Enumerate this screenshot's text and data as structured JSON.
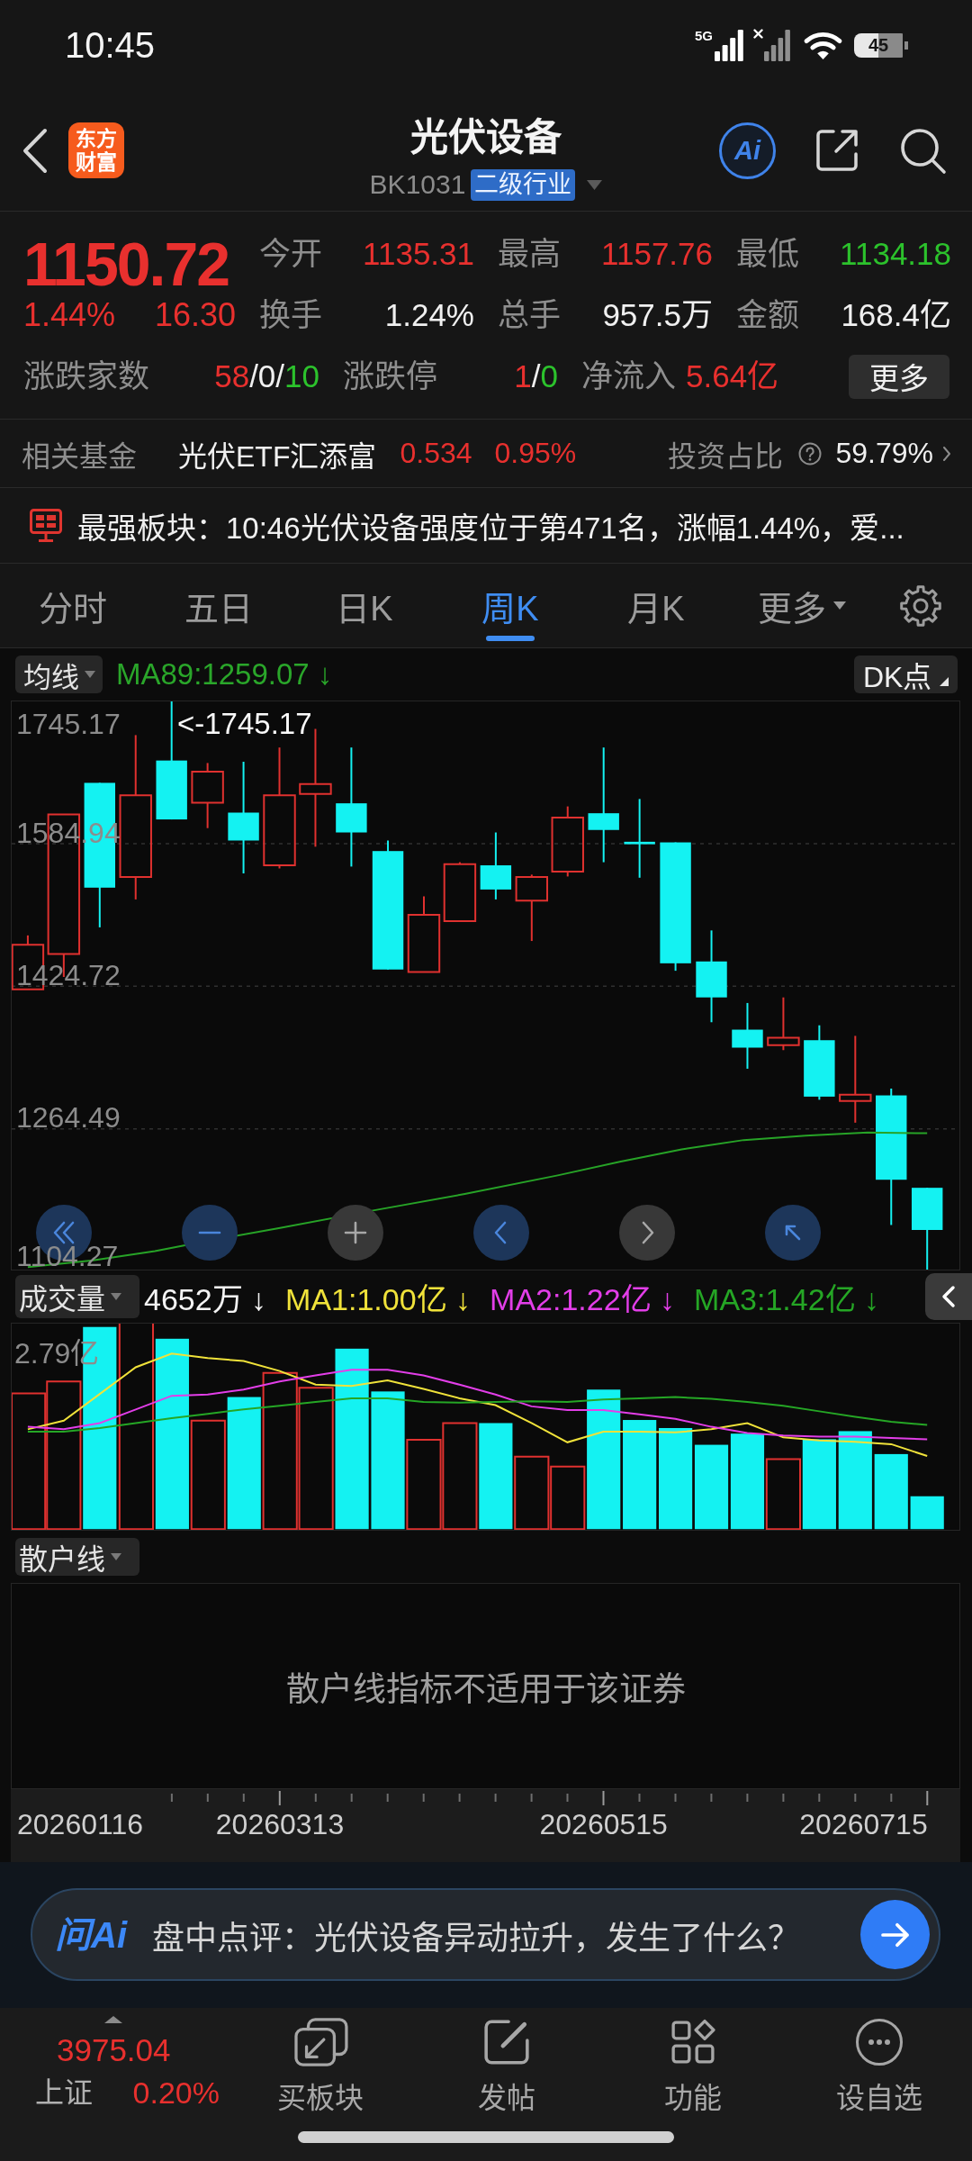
{
  "status_bar": {
    "time": "10:45",
    "network": "5G",
    "battery": "45"
  },
  "header": {
    "logo": "东方财富",
    "title": "光伏设备",
    "code": "BK1031",
    "tag": "二级行业",
    "ai_label": "Ai"
  },
  "quote": {
    "price": "1150.72",
    "change_pct": "1.44%",
    "change": "16.30",
    "color": "#e8302e",
    "stats": [
      {
        "label": "今开",
        "value": "1135.31",
        "color": "#e8302e"
      },
      {
        "label": "最高",
        "value": "1157.76",
        "color": "#e8302e"
      },
      {
        "label": "最低",
        "value": "1134.18",
        "color": "#2cc22c"
      },
      {
        "label": "换手",
        "value": "1.24%",
        "color": "#f0f0f0"
      },
      {
        "label": "总手",
        "value": "957.5万",
        "color": "#f0f0f0"
      },
      {
        "label": "金额",
        "value": "168.4亿",
        "color": "#f0f0f0"
      }
    ],
    "breadth": [
      {
        "label": "涨跌家数",
        "parts": [
          {
            "text": "58",
            "color": "#e8302e"
          },
          {
            "text": "/0/",
            "color": "#f0f0f0"
          },
          {
            "text": "10",
            "color": "#2cc22c"
          }
        ]
      },
      {
        "label": "涨跌停",
        "parts": [
          {
            "text": "1",
            "color": "#e8302e"
          },
          {
            "text": "/",
            "color": "#f0f0f0"
          },
          {
            "text": "0",
            "color": "#2cc22c"
          }
        ]
      },
      {
        "label": "净流入",
        "parts": [
          {
            "text": "5.64亿",
            "color": "#e8302e"
          }
        ]
      }
    ],
    "more_button": "更多"
  },
  "fund": {
    "label": "相关基金",
    "name": "光伏ETF汇添富",
    "price": "0.534",
    "change": "0.95%",
    "color": "#e8302e",
    "ratio_label": "投资占比",
    "ratio": "59.79%"
  },
  "news": {
    "text": "最强板块：10:46光伏设备强度位于第471名，涨幅1.44%，爱..."
  },
  "tabs": [
    {
      "label": "分时",
      "selected": false,
      "kind": "period"
    },
    {
      "label": "五日",
      "selected": false,
      "kind": "period"
    },
    {
      "label": "日K",
      "selected": false,
      "kind": "period"
    },
    {
      "label": "周K",
      "selected": true,
      "kind": "period"
    },
    {
      "label": "月K",
      "selected": false,
      "kind": "period"
    },
    {
      "label": "更多",
      "selected": false,
      "kind": "menu"
    }
  ],
  "kline": {
    "indicator": "均线",
    "ma_label": "MA89:1259.07 ↓",
    "dk_label": "DK点",
    "y_labels": [
      "1745.17",
      "1584.94",
      "1424.72",
      "1264.49",
      "1104.27"
    ],
    "high_marker": "<-1745.17",
    "controls": [
      {
        "kind": "jump-start",
        "disabled": false
      },
      {
        "kind": "zoom-out",
        "disabled": false
      },
      {
        "kind": "zoom-in",
        "disabled": true
      },
      {
        "kind": "previous",
        "disabled": false
      },
      {
        "kind": "next",
        "disabled": true
      },
      {
        "kind": "reset",
        "disabled": false
      }
    ]
  },
  "volume": {
    "indicator": "成交量",
    "value": "4652万 ↓",
    "mas": [
      {
        "label": "MA1:1.00亿 ↓",
        "color": "#f0e23a"
      },
      {
        "label": "MA2:1.22亿 ↓",
        "color": "#e23ee8"
      },
      {
        "label": "MA3:1.42亿 ↓",
        "color": "#25a625"
      }
    ],
    "max_label": "2.79亿"
  },
  "retail": {
    "indicator": "散户线",
    "message": "散户线指标不适用于该证券"
  },
  "time_axis": {
    "dates": [
      "20260116",
      "20260313",
      "20260515",
      "20260715"
    ]
  },
  "ai_bar": {
    "logo": "问Ai",
    "prompt": "盘中点评：光伏设备异动拉升，发生了什么？"
  },
  "bottom_nav": {
    "index": {
      "value": "3975.04",
      "name": "上证",
      "change": "0.20%",
      "color": "#e8302e"
    },
    "items": [
      {
        "label": "买板块",
        "kind": "buy"
      },
      {
        "label": "发帖",
        "kind": "post"
      },
      {
        "label": "功能",
        "kind": "apps"
      },
      {
        "label": "设自选",
        "kind": "watchlist"
      }
    ]
  }
}
